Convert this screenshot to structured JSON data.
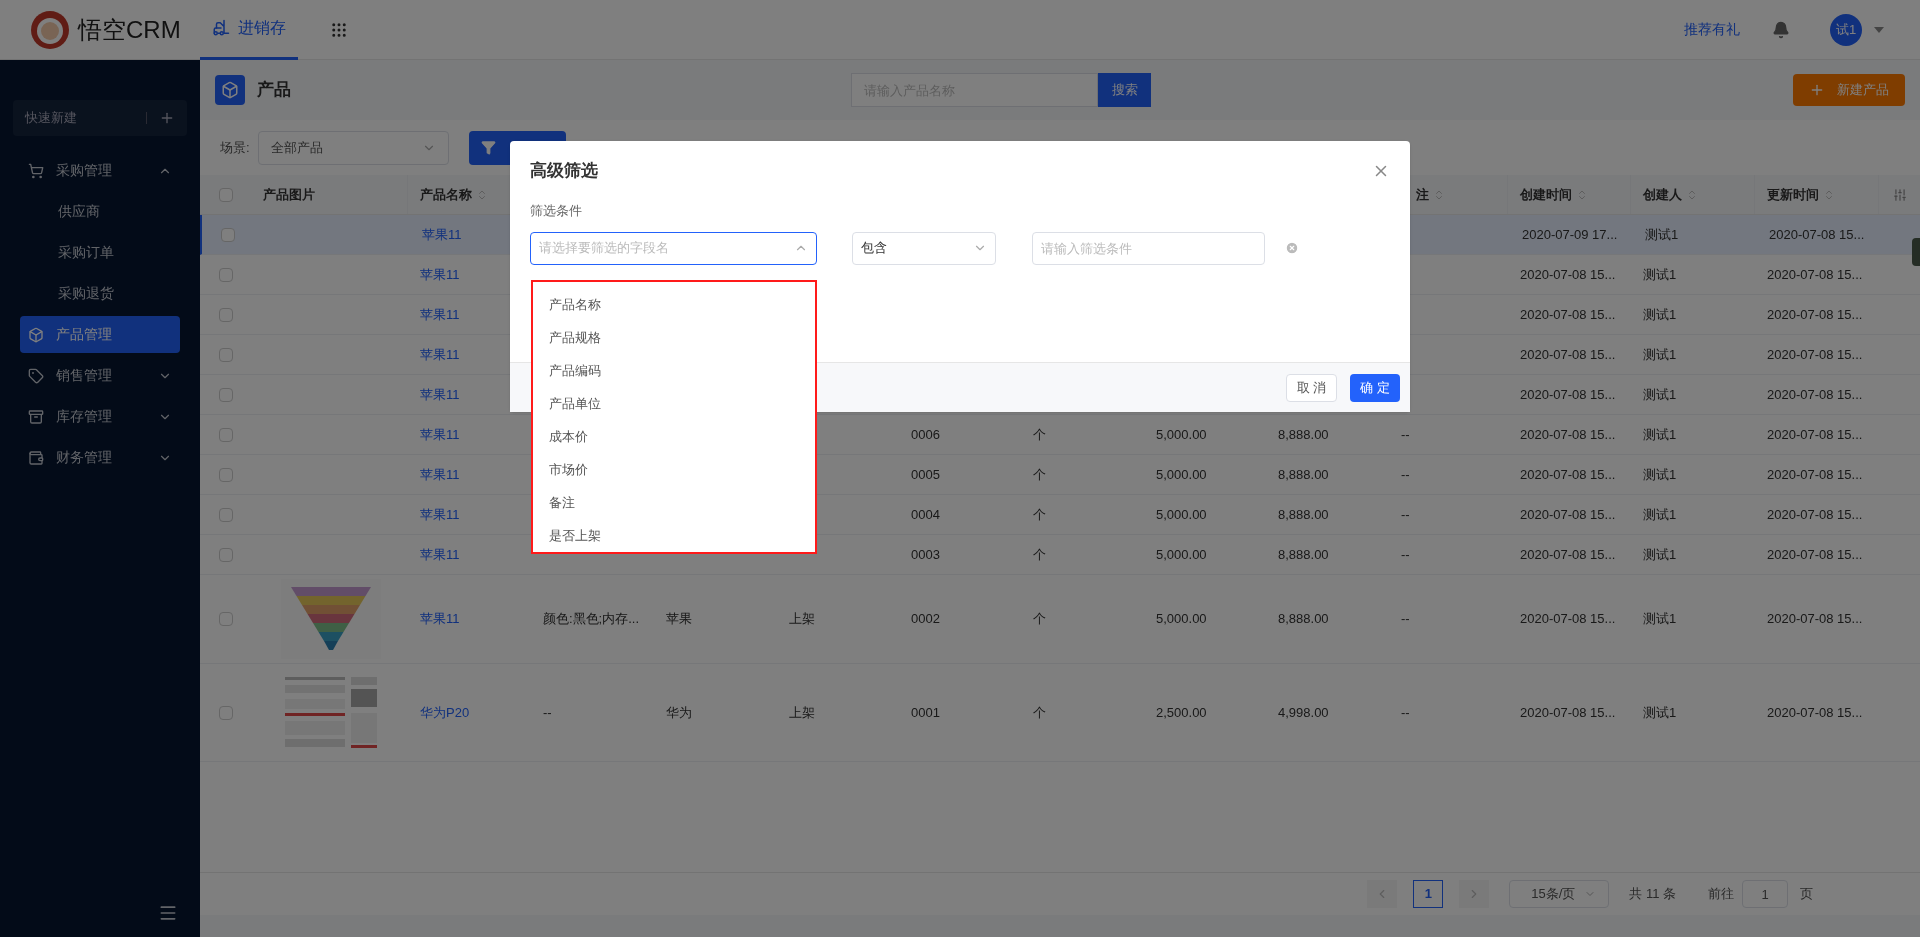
{
  "header": {
    "logo": "悟空CRM",
    "nav": [
      {
        "label": "进销存",
        "selected": true
      }
    ],
    "links": [
      "推荐有礼"
    ],
    "avatar": "试1"
  },
  "sidebar": {
    "quick_new": "快速新建",
    "items": [
      {
        "label": "采购管理",
        "selected": false,
        "expanded": true,
        "children": [
          {
            "label": "供应商",
            "selected": false
          },
          {
            "label": "采购订单",
            "selected": false
          },
          {
            "label": "采购退货",
            "selected": false
          }
        ]
      },
      {
        "label": "产品管理",
        "selected": true
      },
      {
        "label": "销售管理",
        "selected": false,
        "expanded": false
      },
      {
        "label": "库存管理",
        "selected": false,
        "expanded": false
      },
      {
        "label": "财务管理",
        "selected": false,
        "expanded": false
      }
    ]
  },
  "page": {
    "title": "产品",
    "search": {
      "placeholder": "请输入产品名称",
      "button": "搜索"
    },
    "new_button": "新建产品"
  },
  "filter": {
    "label": "场景:",
    "scene": "全部产品"
  },
  "table": {
    "all_checked": false,
    "columns": [
      {
        "label": "产品图片",
        "sortable": false
      },
      {
        "label": "产品名称",
        "sortable": true
      },
      null,
      null,
      null,
      null,
      null,
      null,
      null,
      {
        "label": "注",
        "sortable": true
      },
      {
        "label": "创建时间",
        "sortable": true
      },
      {
        "label": "创建人",
        "sortable": true
      },
      {
        "label": "更新时间",
        "sortable": true
      }
    ],
    "rows": [
      {
        "selected": true,
        "checked": false,
        "cells": [
          "",
          "苹果11",
          null,
          null,
          null,
          null,
          null,
          null,
          null,
          null,
          "2020-07-09 17...",
          "测试1",
          "2020-07-08 15..."
        ]
      },
      {
        "selected": false,
        "checked": false,
        "cells": [
          "",
          "苹果11",
          null,
          null,
          null,
          null,
          null,
          null,
          null,
          null,
          "2020-07-08 15...",
          "测试1",
          "2020-07-08 15..."
        ]
      },
      {
        "selected": false,
        "checked": false,
        "cells": [
          "",
          "苹果11",
          null,
          null,
          null,
          null,
          null,
          null,
          null,
          null,
          "2020-07-08 15...",
          "测试1",
          "2020-07-08 15..."
        ]
      },
      {
        "selected": false,
        "checked": false,
        "cells": [
          "",
          "苹果11",
          null,
          null,
          null,
          null,
          null,
          null,
          null,
          null,
          "2020-07-08 15...",
          "测试1",
          "2020-07-08 15..."
        ]
      },
      {
        "selected": false,
        "checked": false,
        "cells": [
          "",
          "苹果11",
          null,
          null,
          null,
          null,
          null,
          null,
          null,
          null,
          "2020-07-08 15...",
          "测试1",
          "2020-07-08 15..."
        ]
      },
      {
        "selected": false,
        "checked": false,
        "cells": [
          "",
          "苹果11",
          null,
          null,
          null,
          "0006",
          "个",
          "5,000.00",
          "8,888.00",
          "--",
          "2020-07-08 15...",
          "测试1",
          "2020-07-08 15..."
        ]
      },
      {
        "selected": false,
        "checked": false,
        "cells": [
          "",
          "苹果11",
          null,
          null,
          null,
          "0005",
          "个",
          "5,000.00",
          "8,888.00",
          "--",
          "2020-07-08 15...",
          "测试1",
          "2020-07-08 15..."
        ]
      },
      {
        "selected": false,
        "checked": false,
        "cells": [
          "",
          "苹果11",
          null,
          null,
          null,
          "0004",
          "个",
          "5,000.00",
          "8,888.00",
          "--",
          "2020-07-08 15...",
          "测试1",
          "2020-07-08 15..."
        ]
      },
      {
        "selected": false,
        "checked": false,
        "cells": [
          "",
          "苹果11",
          null,
          null,
          null,
          "0003",
          "个",
          "5,000.00",
          "8,888.00",
          "--",
          "2020-07-08 15...",
          "测试1",
          "2020-07-08 15..."
        ]
      },
      {
        "selected": false,
        "checked": false,
        "cells": [
          "",
          "苹果11",
          "颜色:黑色;内存...",
          "苹果",
          "上架",
          "0002",
          "个",
          "5,000.00",
          "8,888.00",
          "--",
          "2020-07-08 15...",
          "测试1",
          "2020-07-08 15..."
        ]
      },
      {
        "selected": false,
        "checked": false,
        "cells": [
          "",
          "华为P20",
          "--",
          "华为",
          "上架",
          "0001",
          "个",
          "2,500.00",
          "4,998.00",
          "--",
          "2020-07-08 15...",
          "测试1",
          "2020-07-08 15..."
        ]
      }
    ]
  },
  "pagination": {
    "pages": [
      {
        "label": "1",
        "selected": true
      }
    ],
    "page_size": "15条/页",
    "total": "共 11 条",
    "goto_label": "前往",
    "goto_value": "1",
    "goto_suffix": "页"
  },
  "modal": {
    "title": "高级筛选",
    "condition_label": "筛选条件",
    "field": {
      "placeholder": "请选择要筛选的字段名",
      "expanded": true
    },
    "operator": "包含",
    "value": {
      "placeholder": "请输入筛选条件"
    },
    "options": [
      "产品名称",
      "产品规格",
      "产品编码",
      "产品单位",
      "成本价",
      "市场价",
      "备注",
      "是否上架"
    ],
    "buttons": [
      {
        "label": "取 消",
        "kind": "secondary"
      },
      {
        "label": "确 定",
        "kind": "primary"
      }
    ]
  }
}
